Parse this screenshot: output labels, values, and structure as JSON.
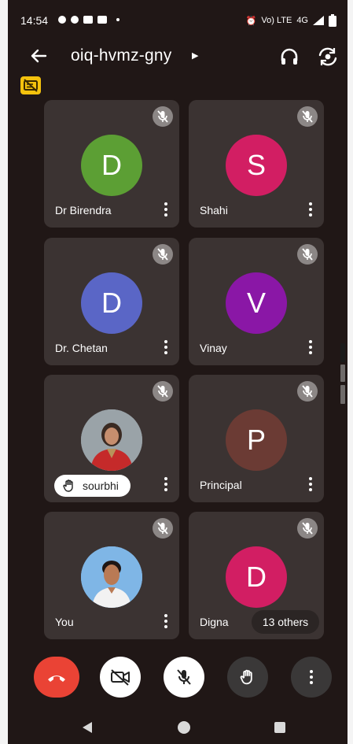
{
  "status_bar": {
    "time": "14:54",
    "network_text": "Vo) LTE",
    "net_gen": "4G"
  },
  "app_bar": {
    "meeting_code": "oiq-hvmz-gny"
  },
  "participants": [
    {
      "name": "Dr Birendra",
      "initial": "D",
      "color": "#5c9f34"
    },
    {
      "name": "Shahi",
      "initial": "S",
      "color": "#d21e63"
    },
    {
      "name": "Dr. Chetan",
      "initial": "D",
      "color": "#5a66c6"
    },
    {
      "name": "Vinay",
      "initial": "V",
      "color": "#8a17a6"
    },
    {
      "name": "sourbhi",
      "initial": "",
      "color": "#7a8a95"
    },
    {
      "name": "Principal",
      "initial": "P",
      "color": "#6b3b34"
    },
    {
      "name": "You",
      "initial": "",
      "color": "#7fb6e6"
    },
    {
      "name": "Digna",
      "initial": "D",
      "color": "#d21e63"
    }
  ],
  "others_chip": "13 others",
  "controls": {
    "end_call_color": "#ea4335",
    "hand_button_color": "#3a3838"
  },
  "icons": {
    "mic_off": "mic-off-icon",
    "hand": "raised-hand-icon",
    "captions": "captions-off-icon"
  }
}
